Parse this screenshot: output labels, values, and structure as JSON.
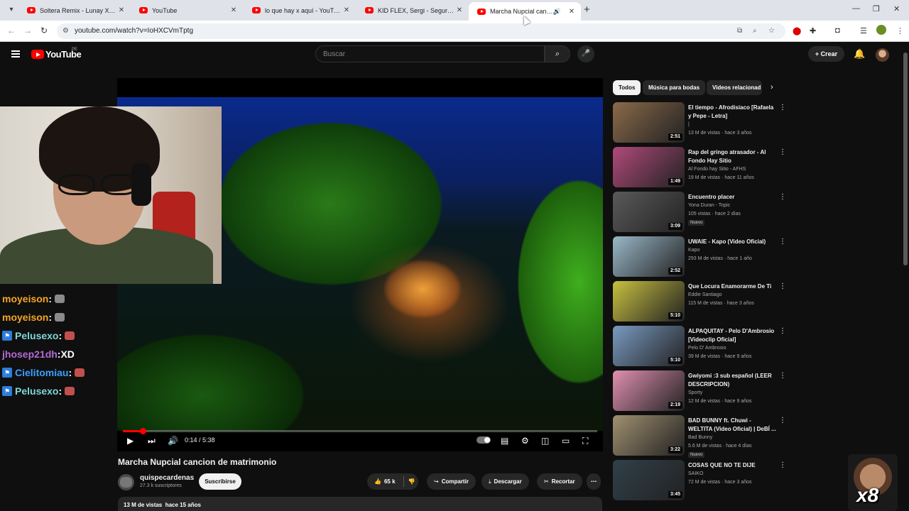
{
  "browser": {
    "tabs": [
      {
        "title": "Soltera Remix - Lunay X Daddy"
      },
      {
        "title": "YouTube"
      },
      {
        "title": "lo que hay x aquí - YouTube"
      },
      {
        "title": "KID FLEX, Sergi - Seguro Te Pierdo"
      },
      {
        "title": "Marcha Nupcial cancion de"
      }
    ],
    "url": "youtube.com/watch?v=IoHXCVmTptg"
  },
  "youtube": {
    "logo_text": "YouTube",
    "country": "PE",
    "search_placeholder": "Buscar",
    "create_label": "Crear"
  },
  "player": {
    "time": "0:14 / 5:38",
    "progress_fraction": 0.0414,
    "accent": "#ff0000"
  },
  "video": {
    "title": "Marcha Nupcial cancion de matrimonio",
    "channel": "quispecardenas",
    "subscribers": "27.3 k suscriptores",
    "subscribe_label": "Suscribirse",
    "likes": "65 k",
    "share_label": "Compartir",
    "download_label": "Descargar",
    "clip_label": "Recortar",
    "views": "13 M de vistas",
    "age": "hace 15 años"
  },
  "chat": [
    {
      "user": "moyeison",
      "msg": "",
      "color": "#f5a623"
    },
    {
      "user": "moyeison",
      "msg": "",
      "color": "#f5a623"
    },
    {
      "user": "Pelusexo",
      "msg": "",
      "color": "#7fd6d6"
    },
    {
      "user": "jhosep21dh",
      "msg": "XD",
      "color": "#b36bd6"
    },
    {
      "user": "Cielitomiau",
      "msg": "",
      "color": "#3aa0ff"
    },
    {
      "user": "Pelusexo",
      "msg": "",
      "color": "#7fd6d6"
    }
  ],
  "chips": [
    "Todos",
    "Música para bodas",
    "Videos relacionad"
  ],
  "recommendations": [
    {
      "title": "El tiempo - Afrodisiaco [Rafaela y Pepe - Letra]",
      "channel": "|",
      "meta": "13 M de vistas · hace 3 años",
      "duration": "2:51",
      "badge": "",
      "bg": "#8a6a4a"
    },
    {
      "title": "Rap del gringo atrasador - Al Fondo Hay Sitio",
      "channel": "Al Fondo hay Sitio - AFHS",
      "meta": "19 M de vistas · hace 11 años",
      "duration": "1:49",
      "badge": "",
      "bg": "#b04a7a"
    },
    {
      "title": "Encuentro placer",
      "channel": "Yona Duran - Topic",
      "meta": "105 vistas · hace 2 días",
      "duration": "3:09",
      "badge": "Nuevo",
      "bg": "#5a5a5a"
    },
    {
      "title": "UWAIE - Kapo (Video Oficial)",
      "channel": "Kapo",
      "meta": "293 M de vistas · hace 1 año",
      "duration": "2:52",
      "badge": "",
      "bg": "#9ab8c8"
    },
    {
      "title": "Que Locura Enamorarme De Ti",
      "channel": "Eddie Santiago",
      "meta": "115 M de vistas · hace 3 años",
      "duration": "5:10",
      "badge": "",
      "bg": "#c8c040"
    },
    {
      "title": "ALPAQUITAY - Pelo D'Ambrosio [Videoclip Oficial]",
      "channel": "Pelo D' Ambrosio",
      "meta": "39 M de vistas · hace 9 años",
      "duration": "5:10",
      "badge": "",
      "bg": "#7a9ac0"
    },
    {
      "title": "Gwiyomi :3 sub español (LEER DESCRIPCION)",
      "channel": "Sporty",
      "meta": "12 M de vistas · hace 9 años",
      "duration": "2:19",
      "badge": "",
      "bg": "#e090b0"
    },
    {
      "title": "BAD BUNNY ft. Chuwi - WELTITA (Video Oficial) | DeBÍ ...",
      "channel": "Bad Bunny",
      "meta": "5.6 M de vistas · hace 4 días",
      "duration": "3:22",
      "badge": "Nuevo",
      "bg": "#a09070"
    },
    {
      "title": "COSAS QUE NO TE DIJE",
      "channel": "SAIKO",
      "meta": "72 M de vistas · hace 3 años",
      "duration": "3:45",
      "badge": "",
      "bg": "#30404a"
    }
  ],
  "overlay": {
    "emote_text": "x8"
  }
}
